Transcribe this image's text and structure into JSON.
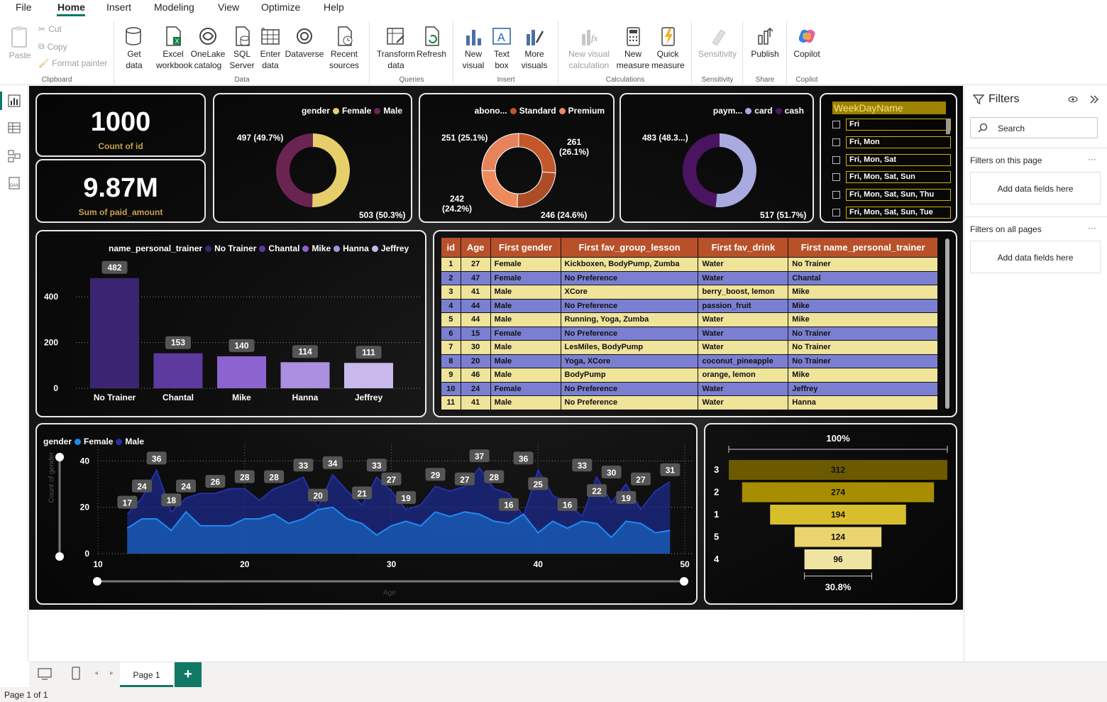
{
  "menu": {
    "items": [
      "File",
      "Home",
      "Insert",
      "Modeling",
      "View",
      "Optimize",
      "Help"
    ]
  },
  "ribbon": {
    "clipboard": {
      "paste": "Paste",
      "cut": "Cut",
      "copy": "Copy",
      "format_painter": "Format painter",
      "group": "Clipboard"
    },
    "data": {
      "get_data": "Get data",
      "excel": "Excel workbook",
      "onelake": "OneLake catalog",
      "sql": "SQL Server",
      "enter": "Enter data",
      "dataverse": "Dataverse",
      "recent": "Recent sources",
      "group": "Data"
    },
    "queries": {
      "transform": "Transform data",
      "refresh": "Refresh",
      "group": "Queries"
    },
    "insert": {
      "new_visual": "New visual",
      "text_box": "Text box",
      "more_visuals": "More visuals",
      "group": "Insert"
    },
    "calculations": {
      "new_visual_calc": "New visual calculation",
      "new_measure": "New measure",
      "quick_measure": "Quick measure",
      "group": "Calculations"
    },
    "sensitivity": {
      "label": "Sensitivity",
      "group": "Sensitivity"
    },
    "share": {
      "publish": "Publish",
      "group": "Share"
    },
    "copilot": {
      "label": "Copilot",
      "group": "Copilot"
    }
  },
  "kpis": [
    {
      "value": "1000",
      "label": "Count of id"
    },
    {
      "value": "9.87M",
      "label": "Sum of paid_amount"
    }
  ],
  "donuts": [
    {
      "legend_title": "gender",
      "series": [
        {
          "name": "Female",
          "color": "#e6cf6a"
        },
        {
          "name": "Male",
          "color": "#6b2452"
        }
      ],
      "values": [
        503,
        497
      ],
      "labels": [
        "503 (50.3%)",
        "497 (49.7%)"
      ]
    },
    {
      "legend_title": "abono...",
      "series": [
        {
          "name": "Standard",
          "color": "#c4572a"
        },
        {
          "name": "Premium",
          "color": "#ee8a5c"
        }
      ],
      "values": [
        261,
        246,
        242,
        251
      ],
      "labels": [
        "261 (26.1%)",
        "246 (24.6%)",
        "242 (24.2%)",
        "251 (25.1%)"
      ]
    },
    {
      "legend_title": "paym...",
      "series": [
        {
          "name": "card",
          "color": "#a9aae0"
        },
        {
          "name": "cash",
          "color": "#4a1460"
        }
      ],
      "values": [
        517,
        483
      ],
      "labels": [
        "517 (51.7%)",
        "483 (48.3...)"
      ]
    }
  ],
  "weekday_slicer": {
    "title": "WeekDayName",
    "items": [
      "Fri",
      "Fri, Mon",
      "Fri, Mon, Sat",
      "Fri, Mon, Sat, Sun",
      "Fri, Mon, Sat, Sun, Thu",
      "Fri, Mon, Sat, Sun, Tue"
    ]
  },
  "chart_data": [
    {
      "type": "bar",
      "legend_title": "name_personal_trainer",
      "categories": [
        "No Trainer",
        "Chantal",
        "Mike",
        "Hanna",
        "Jeffrey"
      ],
      "values": [
        482,
        153,
        140,
        114,
        111
      ],
      "colors": [
        "#3b2470",
        "#5c3a9e",
        "#8c63cf",
        "#ab8fe0",
        "#c9b8ec"
      ],
      "ylim": [
        0,
        500
      ],
      "yticks": [
        0,
        200,
        400
      ]
    },
    {
      "type": "area",
      "legend_title": "gender",
      "series": [
        {
          "name": "Female",
          "color": "#1e8bf0"
        },
        {
          "name": "Male",
          "color": "#2430a8"
        }
      ],
      "xlabel": "Age",
      "ylabel": "Count of gender",
      "xlim": [
        10,
        50
      ],
      "ylim": [
        0,
        45
      ],
      "xticks": [
        10,
        20,
        30,
        40,
        50
      ],
      "yticks": [
        0,
        20,
        40
      ],
      "x": [
        12,
        13,
        14,
        15,
        16,
        17,
        18,
        19,
        20,
        21,
        22,
        23,
        24,
        25,
        26,
        27,
        28,
        29,
        30,
        31,
        32,
        33,
        34,
        35,
        36,
        37,
        38,
        39,
        40,
        41,
        42,
        43,
        44,
        45,
        46,
        47,
        48,
        49
      ],
      "female": [
        11,
        15,
        15,
        10,
        18,
        12,
        12,
        12,
        15,
        15,
        17,
        13,
        15,
        19,
        20,
        15,
        13,
        8,
        12,
        14,
        12,
        18,
        16,
        18,
        17,
        14,
        13,
        17,
        9,
        14,
        11,
        14,
        13,
        7,
        14,
        13,
        9,
        10
      ],
      "totals": [
        17,
        24,
        36,
        18,
        24,
        26,
        26,
        28,
        28,
        23,
        28,
        30,
        33,
        20,
        34,
        27,
        21,
        33,
        27,
        19,
        21,
        29,
        27,
        29,
        37,
        28,
        26,
        16,
        36,
        25,
        22,
        16,
        33,
        22,
        30,
        19,
        27,
        31
      ],
      "point_labels": [
        [
          12,
          17
        ],
        [
          13,
          24
        ],
        [
          14,
          36
        ],
        [
          15,
          18
        ],
        [
          16,
          24
        ],
        [
          18,
          26
        ],
        [
          20,
          28
        ],
        [
          22,
          28
        ],
        [
          24,
          33
        ],
        [
          25,
          20
        ],
        [
          26,
          34
        ],
        [
          28,
          21
        ],
        [
          29,
          33
        ],
        [
          30,
          27
        ],
        [
          31,
          19
        ],
        [
          33,
          29
        ],
        [
          35,
          27
        ],
        [
          36,
          37
        ],
        [
          37,
          28
        ],
        [
          38,
          16
        ],
        [
          39,
          36
        ],
        [
          40,
          25
        ],
        [
          42,
          16
        ],
        [
          43,
          33
        ],
        [
          44,
          22
        ],
        [
          45,
          30
        ],
        [
          46,
          19
        ],
        [
          47,
          27
        ],
        [
          49,
          31
        ]
      ]
    },
    {
      "type": "funnel",
      "categories": [
        "3",
        "2",
        "1",
        "5",
        "4"
      ],
      "values": [
        312,
        274,
        194,
        124,
        96
      ],
      "colors": [
        "#6b5a00",
        "#a88d00",
        "#d8be2c",
        "#ead470",
        "#f0e4a2"
      ],
      "top_label": "100%",
      "bottom_label": "30.8%"
    }
  ],
  "table": {
    "headers": [
      "id",
      "Age",
      "First gender",
      "First fav_group_lesson",
      "First fav_drink",
      "First name_personal_trainer"
    ],
    "rows": [
      [
        "1",
        "27",
        "Female",
        "Kickboxen, BodyPump, Zumba",
        "Water",
        "No Trainer"
      ],
      [
        "2",
        "47",
        "Female",
        "No Preference",
        "Water",
        "Chantal"
      ],
      [
        "3",
        "41",
        "Male",
        "XCore",
        "berry_boost, lemon",
        "Mike"
      ],
      [
        "4",
        "44",
        "Male",
        "No Preference",
        "passion_fruit",
        "Mike"
      ],
      [
        "5",
        "44",
        "Male",
        "Running, Yoga, Zumba",
        "Water",
        "Mike"
      ],
      [
        "6",
        "15",
        "Female",
        "No Preference",
        "Water",
        "No Trainer"
      ],
      [
        "7",
        "30",
        "Male",
        "LesMiles, BodyPump",
        "Water",
        "No Trainer"
      ],
      [
        "8",
        "20",
        "Male",
        "Yoga, XCore",
        "coconut_pineapple",
        "No Trainer"
      ],
      [
        "9",
        "46",
        "Male",
        "BodyPump",
        "orange, lemon",
        "Mike"
      ],
      [
        "10",
        "24",
        "Female",
        "No Preference",
        "Water",
        "Jeffrey"
      ],
      [
        "11",
        "41",
        "Male",
        "No Preference",
        "Water",
        "Hanna"
      ]
    ]
  },
  "filters": {
    "title": "Filters",
    "search": "Search",
    "on_page": "Filters on this page",
    "on_all": "Filters on all pages",
    "add": "Add data fields here"
  },
  "pages": {
    "tab": "Page 1",
    "status": "Page 1 of 1"
  }
}
